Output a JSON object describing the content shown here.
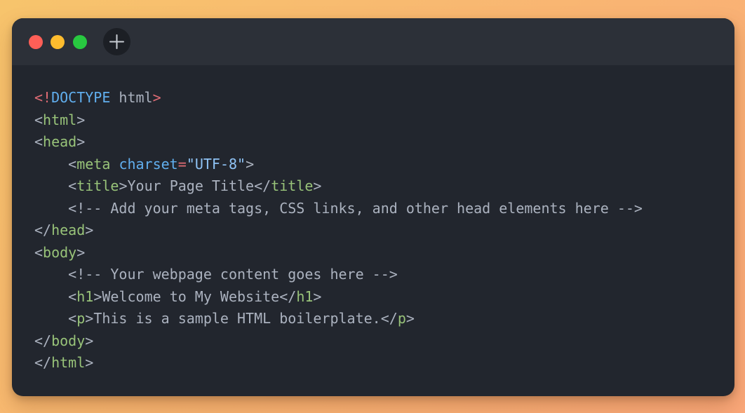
{
  "colors": {
    "background_start": "#f7c46c",
    "background_end": "#fba87a",
    "window": "#22262e",
    "titlebar": "#2c3038",
    "close": "#ff5f57",
    "minimize": "#febc2e",
    "zoom": "#28c840",
    "tag": "#98c379",
    "keyword": "#61afef",
    "string": "#8fc3f5",
    "punct_red": "#e06c75",
    "text": "#abb2bf"
  },
  "titlebar": {
    "close_icon": "close-traffic-light",
    "minimize_icon": "minimize-traffic-light",
    "zoom_icon": "zoom-traffic-light",
    "add_icon": "plus-icon"
  },
  "code": {
    "l1": {
      "open": "<!",
      "keyword": "DOCTYPE",
      "text": " html",
      "close": ">"
    },
    "l2": {
      "open": "<",
      "tag": "html",
      "close": ">"
    },
    "l3": {
      "open": "<",
      "tag": "head",
      "close": ">"
    },
    "l4": {
      "indent": "    ",
      "open": "<",
      "tag": "meta",
      "space": " ",
      "attr": "charset",
      "eq": "=",
      "value": "\"UTF-8\"",
      "close": ">"
    },
    "l5": {
      "indent": "    ",
      "open": "<",
      "tag": "title",
      "close": ">",
      "text": "Your Page Title",
      "endopen": "</",
      "endtag": "title",
      "endclose": ">"
    },
    "l6": {
      "indent": "    ",
      "comment": "<!-- Add your meta tags, CSS links, and other head elements here -->"
    },
    "l7": {
      "open": "</",
      "tag": "head",
      "close": ">"
    },
    "l8": {
      "open": "<",
      "tag": "body",
      "close": ">"
    },
    "l9": {
      "indent": "    ",
      "comment": "<!-- Your webpage content goes here -->"
    },
    "l10": {
      "indent": "    ",
      "open": "<",
      "tag": "h1",
      "close": ">",
      "text": "Welcome to My Website",
      "endopen": "</",
      "endtag": "h1",
      "endclose": ">"
    },
    "l11": {
      "indent": "    ",
      "open": "<",
      "tag": "p",
      "close": ">",
      "text": "This is a sample HTML boilerplate.",
      "endopen": "</",
      "endtag": "p",
      "endclose": ">"
    },
    "l12": {
      "open": "</",
      "tag": "body",
      "close": ">"
    },
    "l13": {
      "open": "</",
      "tag": "html",
      "close": ">"
    }
  }
}
